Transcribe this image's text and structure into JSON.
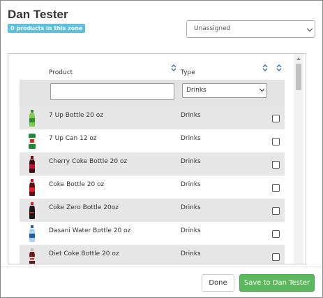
{
  "modal": {
    "title": "Dan Tester",
    "badge": "0 products in this zone",
    "zone_select": {
      "selected": "Unassigned"
    }
  },
  "table": {
    "headers": {
      "product": "Product",
      "type": "Type"
    },
    "filters": {
      "product_value": "",
      "type_selected": "Drinks"
    },
    "rows": [
      {
        "name": "7 Up Bottle 20 oz",
        "type": "Drinks",
        "checked": false,
        "thumb": "green-bottle"
      },
      {
        "name": "7 Up Can 12 oz",
        "type": "Drinks",
        "checked": false,
        "thumb": "green-can"
      },
      {
        "name": "Cherry Coke Bottle 20 oz",
        "type": "Drinks",
        "checked": false,
        "thumb": "dark-bottle-red-label"
      },
      {
        "name": "Coke Bottle 20 oz",
        "type": "Drinks",
        "checked": false,
        "thumb": "red-bottle"
      },
      {
        "name": "Coke Zero Bottle 20oz",
        "type": "Drinks",
        "checked": false,
        "thumb": "black-bottle-red-cap"
      },
      {
        "name": "Dasani Water Bottle 20 oz",
        "type": "Drinks",
        "checked": false,
        "thumb": "blue-bottle"
      },
      {
        "name": "Diet Coke Bottle 20 oz",
        "type": "Drinks",
        "checked": false,
        "thumb": "silver-bottle-red"
      }
    ]
  },
  "footer": {
    "done_label": "Done",
    "save_label": "Save to Dan Tester"
  },
  "colors": {
    "badge": "#5bc0de",
    "save": "#5cb85c",
    "row_alt": "#e6e6e6"
  }
}
